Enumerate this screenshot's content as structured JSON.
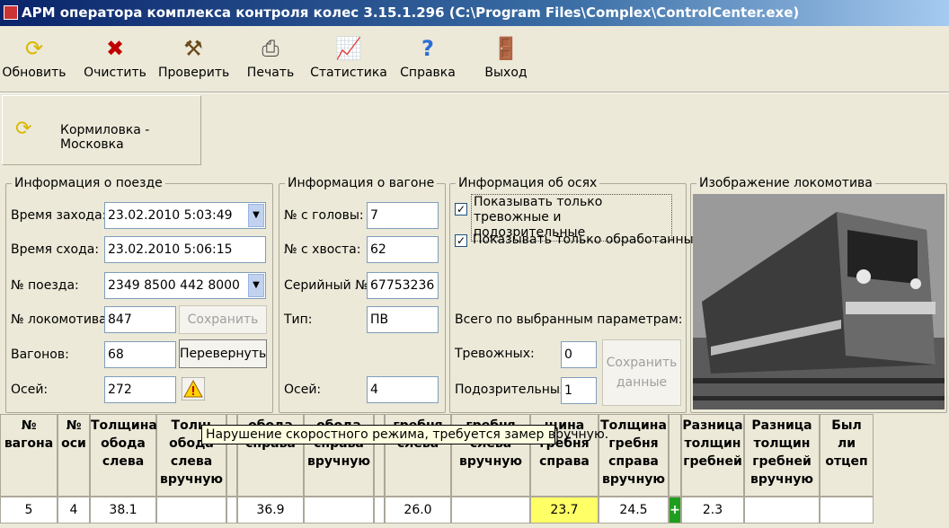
{
  "window": {
    "title": "АРМ оператора комплекса контроля колес 3.15.1.296 (C:\\Program Files\\Complex\\ControlCenter.exe)"
  },
  "toolbar": {
    "items": [
      {
        "label": "Обновить",
        "icon": "refresh-icon"
      },
      {
        "label": "Очистить",
        "icon": "clear-icon"
      },
      {
        "label": "Проверить",
        "icon": "check-icon"
      },
      {
        "label": "Печать",
        "icon": "printer-icon"
      },
      {
        "label": "Статистика",
        "icon": "chart-icon"
      },
      {
        "label": "Справка",
        "icon": "help-icon"
      },
      {
        "label": "Выход",
        "icon": "exit-door-icon"
      }
    ]
  },
  "station": {
    "label": "Кормиловка - Московка",
    "icon": "refresh-icon"
  },
  "train_info": {
    "legend": "Информация о поезде",
    "arrival_label": "Время захода:",
    "arrival_value": "23.02.2010 5:03:49",
    "departure_label": "Время схода:",
    "departure_value": "23.02.2010 5:06:15",
    "train_no_label": "№ поезда:",
    "train_no_value": "2349  8500 442 8000",
    "loco_label": "№ локомотива:",
    "loco_value": "847",
    "save_button": "Сохранить",
    "wagons_label": "Вагонов:",
    "wagons_value": "68",
    "flip_button": "Перевернуть",
    "axles_label": "Осей:",
    "axles_value": "272"
  },
  "wagon_info": {
    "legend": "Информация о вагоне",
    "from_head_label": "№ с головы:",
    "from_head_value": "7",
    "from_tail_label": "№ с хвоста:",
    "from_tail_value": "62",
    "serial_label": "Серийный №:",
    "serial_value": "67753236",
    "type_label": "Тип:",
    "type_value": "ПВ",
    "axles_label": "Осей:",
    "axles_value": "4"
  },
  "axle_info": {
    "legend": "Информация об осях",
    "chk_alarm_label": "Показывать только тревожные и подозрительные",
    "chk_alarm_checked": true,
    "chk_processed_label": "Показывать только обработанные",
    "chk_processed_checked": true,
    "totals_label": "Всего по выбранным параметрам:",
    "alarm_label": "Тревожных:",
    "alarm_value": "0",
    "suspicious_label": "Подозрительных:",
    "suspicious_value": "1",
    "save_data_button": "Сохранить данные"
  },
  "loco_image": {
    "legend": "Изображение локомотива"
  },
  "table": {
    "headers": [
      "№ вагона",
      "№ оси",
      "Толщина обода слева",
      "Толщина обода слева вручную",
      "",
      "Толщина обода справа",
      "Толщина обода справа вручную",
      "",
      "Толщина гребня слева",
      "Толщина гребня слева вручную",
      "Толщина гребня справа",
      "Толщина гребня справа вручную",
      "",
      "Разница толщин гребней",
      "Разница толщин гребней вручную",
      "Был ли отцеп"
    ],
    "header_visible": [
      "№ вагона",
      "№ оси",
      "Толщина обода слева",
      "Толщ обода слева вручную",
      "",
      "обода справа",
      "обода справа вручную",
      "",
      "гребня слева",
      "гребня слева вручную",
      "щина гребня справа",
      "Толщина гребня справа вручную",
      "",
      "Разница толщин гребней",
      "Разница толщин гребней вручную",
      "Был ли отцеп"
    ],
    "row": [
      "5",
      "4",
      "38.1",
      "",
      "",
      "36.9",
      "",
      "",
      "26.0",
      "",
      "23.7",
      "24.5",
      "+",
      "2.3",
      "",
      ""
    ],
    "highlight_color": "#ffff66",
    "plus_color": "#1e9e1e"
  },
  "tooltip": {
    "text": "Нарушение скоростного режима, требуется замер вручную."
  }
}
